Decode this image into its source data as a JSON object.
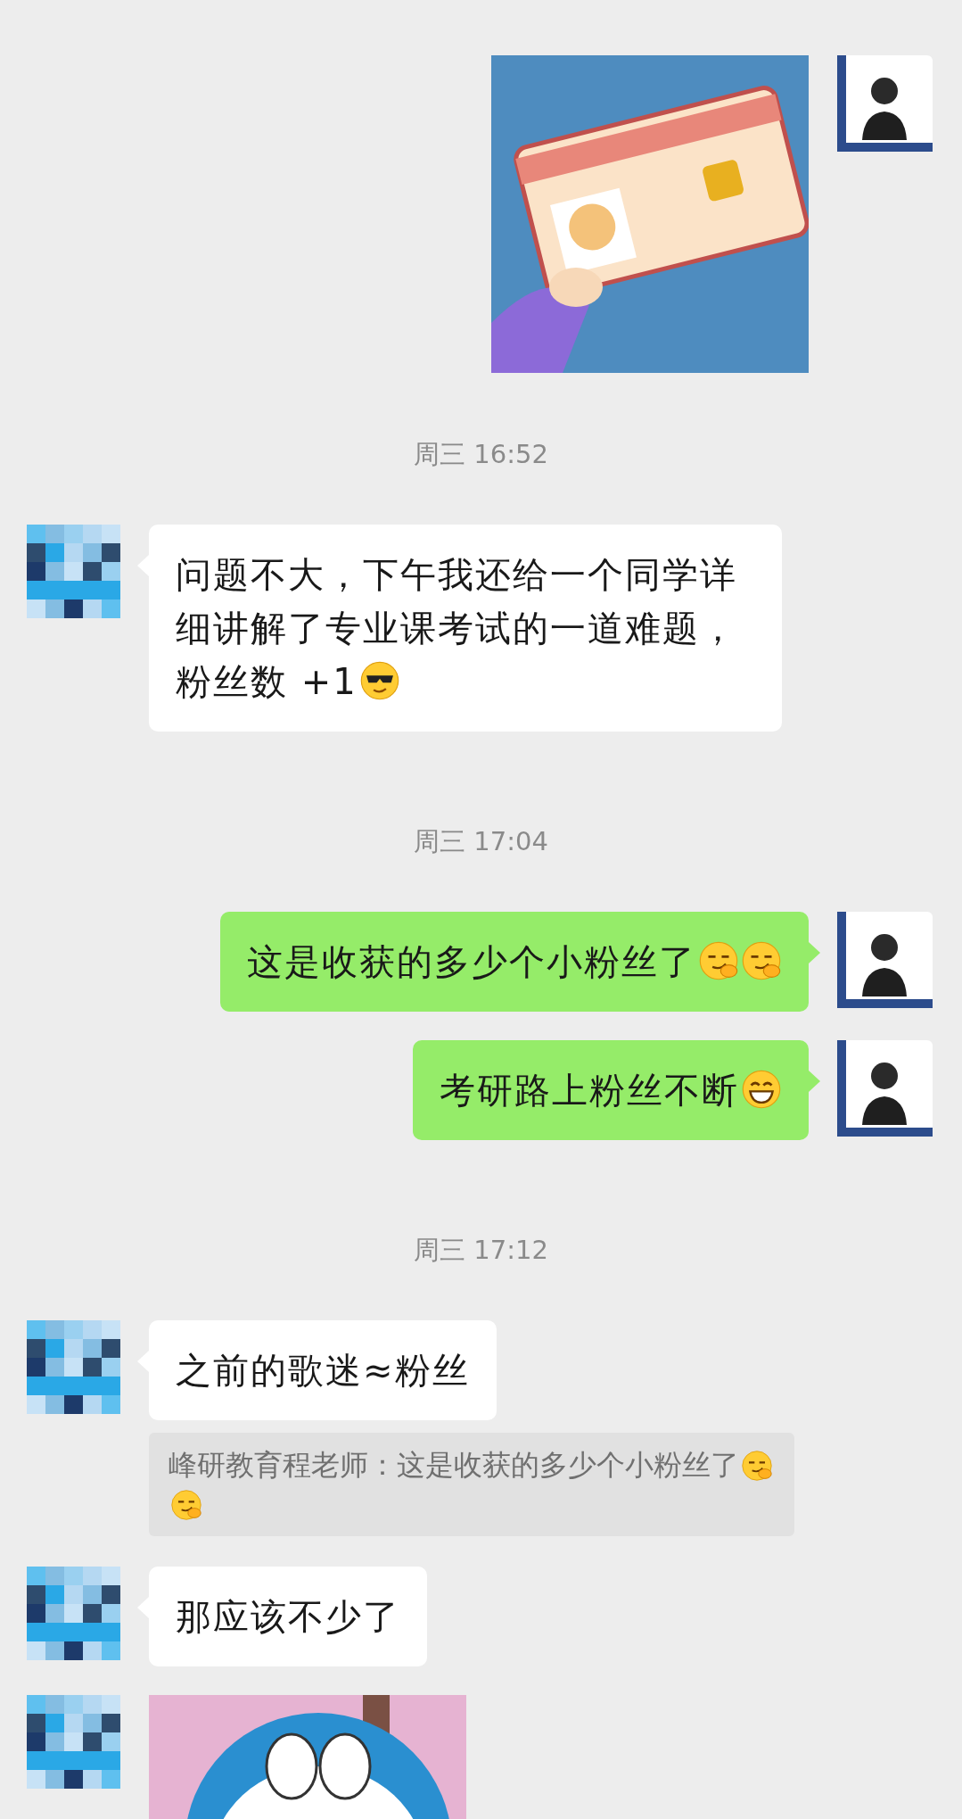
{
  "messages": [
    {
      "kind": "sent_image"
    },
    {
      "kind": "time",
      "text": "周三 16:52"
    },
    {
      "kind": "received",
      "text": "问题不大，下午我还给一个同学详细讲解了专业课考试的一道难题，粉丝数 +1",
      "emojis": [
        {
          "kind": "sunglasses"
        }
      ]
    },
    {
      "kind": "time",
      "text": "周三 17:04"
    },
    {
      "kind": "sent",
      "text": "这是收获的多少个小粉丝了",
      "emojis": [
        {
          "kind": "smirk"
        },
        {
          "kind": "smirk"
        }
      ]
    },
    {
      "kind": "sent",
      "text": "考研路上粉丝不断",
      "emojis": [
        {
          "kind": "grin"
        }
      ]
    },
    {
      "kind": "time",
      "text": "周三 17:12"
    },
    {
      "kind": "received",
      "text": "之前的歌迷≈粉丝",
      "quote": {
        "text": "峰研教育程老师：这是收获的多少个小粉丝了",
        "emojis": [
          {
            "kind": "smirk"
          },
          {
            "kind": "smirk"
          }
        ]
      }
    },
    {
      "kind": "received",
      "text": "那应该不少了"
    },
    {
      "kind": "received_image"
    }
  ]
}
